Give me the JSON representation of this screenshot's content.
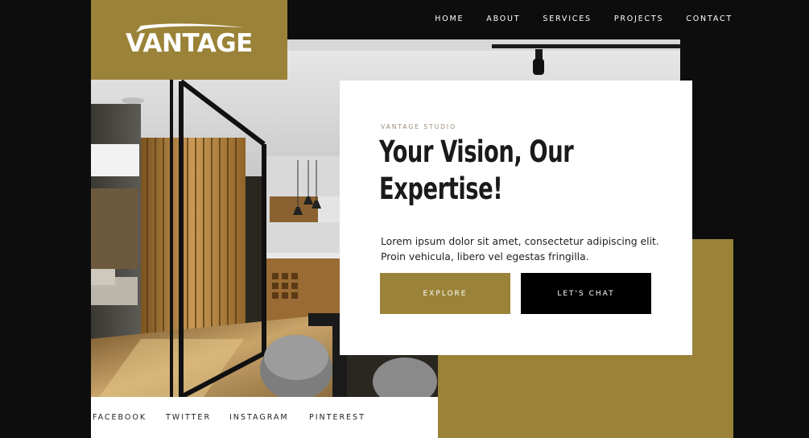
{
  "brand": {
    "logo_text": "VANTAGE"
  },
  "nav": {
    "items": [
      {
        "label": "HOME"
      },
      {
        "label": "ABOUT"
      },
      {
        "label": "SERVICES"
      },
      {
        "label": "PROJECTS"
      },
      {
        "label": "CONTACT"
      }
    ]
  },
  "hero": {
    "eyebrow": "VANTAGE STUDIO",
    "headline_line1": "Your Vision, Our",
    "headline_line2": "Expertise!",
    "body_line1": "Lorem ipsum dolor sit amet, consectetur adipiscing elit.",
    "body_line2": "Proin vehicula, libero vel egestas fringilla.",
    "explore_label": "EXPLORE",
    "chat_label": "LET'S CHAT"
  },
  "social": {
    "links": [
      {
        "label": "FACEBOOK"
      },
      {
        "label": "TWITTER"
      },
      {
        "label": "INSTAGRAM"
      },
      {
        "label": "PINTEREST"
      }
    ]
  },
  "colors": {
    "background": "#0d0d0d",
    "accent_gold": "#9a8338",
    "card": "#ffffff",
    "text_dark": "#1a1a1a"
  }
}
